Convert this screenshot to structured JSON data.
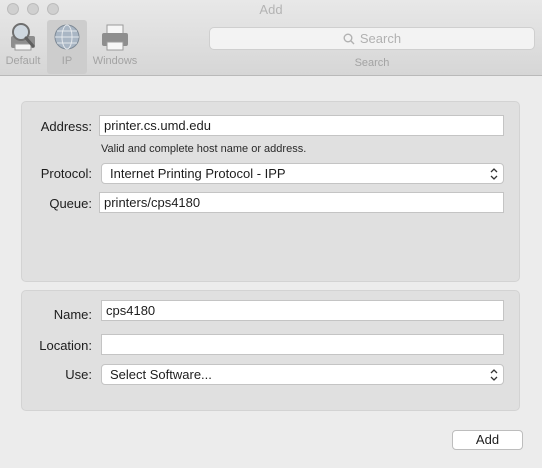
{
  "window": {
    "title": "Add"
  },
  "toolbar": {
    "tools": [
      {
        "label": "Default",
        "icon": "default-printer-icon"
      },
      {
        "label": "IP",
        "icon": "globe-icon",
        "selected": true
      },
      {
        "label": "Windows",
        "icon": "windows-printer-icon"
      }
    ],
    "search": {
      "placeholder": "Search",
      "caption": "Search",
      "icon": "magnifier-icon"
    }
  },
  "ip_section": {
    "address_label": "Address:",
    "address_value": "printer.cs.umd.edu",
    "address_hint": "Valid and complete host name or address.",
    "protocol_label": "Protocol:",
    "protocol_value": "Internet Printing Protocol - IPP",
    "queue_label": "Queue:",
    "queue_value": "printers/cps4180"
  },
  "printer_section": {
    "name_label": "Name:",
    "name_value": "cps4180",
    "location_label": "Location:",
    "location_value": "",
    "use_label": "Use:",
    "use_value": "Select Software..."
  },
  "actions": {
    "add_label": "Add"
  }
}
